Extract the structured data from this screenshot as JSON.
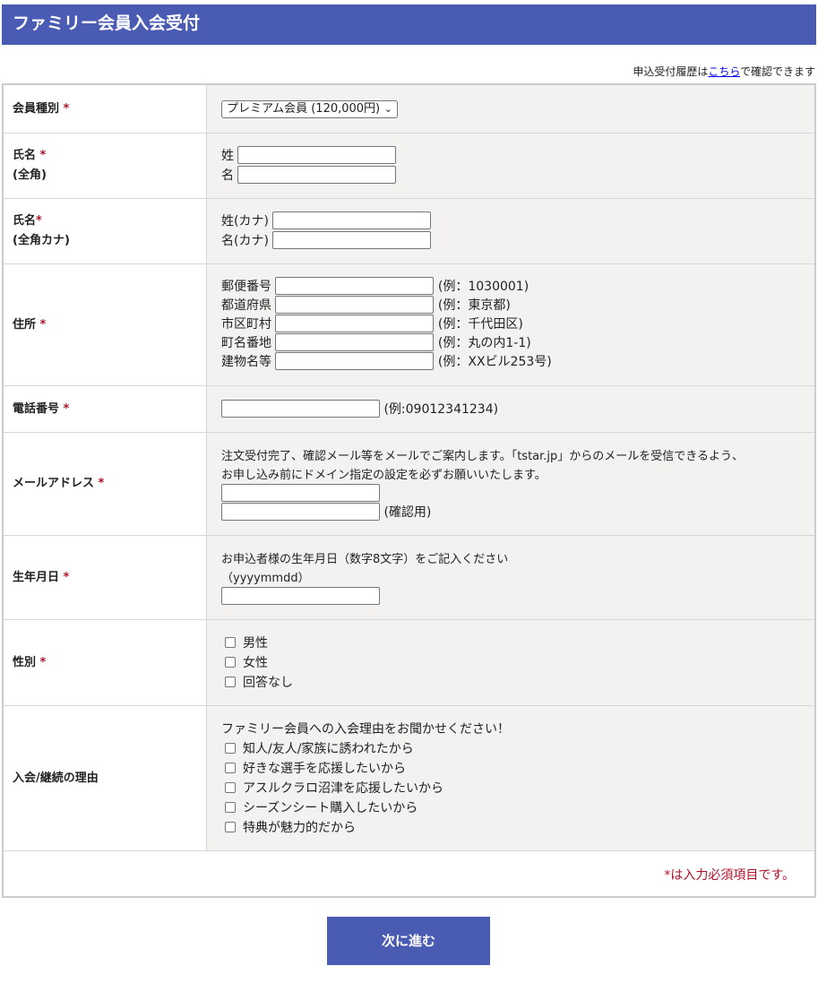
{
  "header": {
    "title": "ファミリー会員入会受付"
  },
  "history": {
    "prefix": "申込受付履歴は",
    "link": "こちら",
    "suffix": "で確認できます"
  },
  "required_mark": "*",
  "fields": {
    "member_type": {
      "label": "会員種別",
      "selected": "プレミアム会員 (120,000円)"
    },
    "name": {
      "label1": "氏名",
      "label2": "(全角)",
      "last": "姓",
      "first": "名"
    },
    "kana": {
      "label1": "氏名",
      "label2": "(全角カナ)",
      "last": "姓(カナ)",
      "first": "名(カナ)"
    },
    "address": {
      "label": "住所",
      "items": [
        {
          "label": "郵便番号",
          "example": "(例：1030001)"
        },
        {
          "label": "都道府県",
          "example": "(例：東京都)"
        },
        {
          "label": "市区町村",
          "example": "(例：千代田区)"
        },
        {
          "label": "町名番地",
          "example": "(例：丸の内1-1)"
        },
        {
          "label": "建物名等",
          "example": "(例：XXビル253号)"
        }
      ]
    },
    "phone": {
      "label": "電話番号",
      "example": "(例:09012341234)"
    },
    "email": {
      "label": "メールアドレス",
      "notice1": "注文受付完了、確認メール等をメールでご案内します。「tstar.jp」からのメールを受信できるよう、",
      "notice2": "お申し込み前にドメイン指定の設定を必ずお願いいたします。",
      "confirm": "(確認用)"
    },
    "birthday": {
      "label": "生年月日",
      "hint1": "お申込者様の生年月日（数字8文字）をご記入ください",
      "hint2": "（yyyymmdd）"
    },
    "gender": {
      "label": "性別",
      "options": [
        "男性",
        "女性",
        "回答なし"
      ]
    },
    "reason": {
      "label": "入会/継続の理由",
      "prompt": "ファミリー会員への入会理由をお聞かせください！",
      "options": [
        "知人/友人/家族に誘われたから",
        "好きな選手を応援したいから",
        "アスルクラロ沼津を応援したいから",
        "シーズンシート購入したいから",
        "特典が魅力的だから"
      ]
    }
  },
  "footer_note": "*は入力必須項目です。",
  "next_button": "次に進む"
}
